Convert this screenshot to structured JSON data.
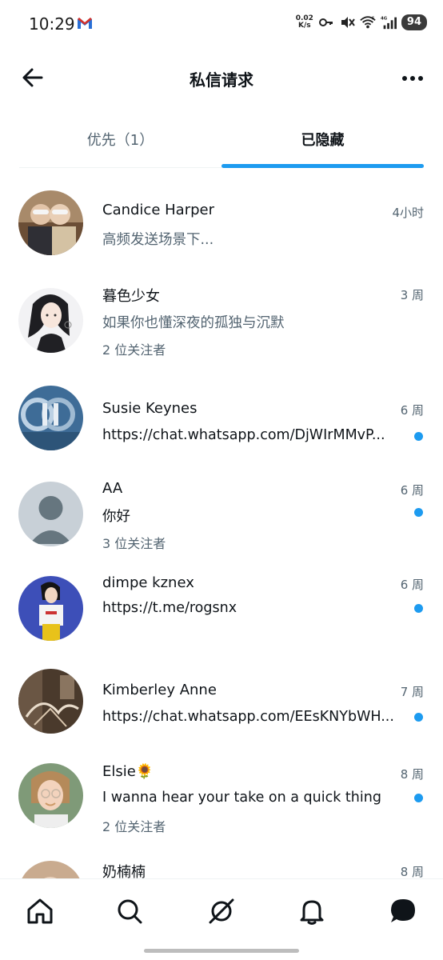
{
  "status_bar": {
    "time": "10:29",
    "speed_value": "0.02",
    "speed_unit": "K/s",
    "battery": "94",
    "network": "4G",
    "wifi_badge": "6"
  },
  "header": {
    "title": "私信请求"
  },
  "tabs": [
    {
      "label": "优先（1）",
      "active": false
    },
    {
      "label": "已隐藏",
      "active": true
    }
  ],
  "conversations": [
    {
      "name": "Candice Harper",
      "time": "4小时",
      "message": "高频发送场景下...",
      "followers": "",
      "unread": false
    },
    {
      "name": "暮色少女",
      "time": "3 周",
      "message": "如果你也懂深夜的孤独与沉默",
      "followers": "2 位关注者",
      "unread": false
    },
    {
      "name": "Susie Keynes",
      "time": "6 周",
      "message": "https://chat.whatsapp.com/DjWIrMMvP...",
      "followers": "",
      "unread": true
    },
    {
      "name": "AA",
      "time": "6 周",
      "message": "你好",
      "followers": "3 位关注者",
      "unread": true
    },
    {
      "name": "dimpe kznex",
      "time": "6 周",
      "message": "https://t.me/rogsnx",
      "followers": "",
      "unread": true
    },
    {
      "name": "Kimberley Anne",
      "time": "7 周",
      "message": "https://chat.whatsapp.com/EEsKNYbWH...",
      "followers": "",
      "unread": true
    },
    {
      "name": "Elsie🌻",
      "time": "8 周",
      "message": "I wanna hear your take on a quick thing",
      "followers": "2 位关注者",
      "unread": true
    },
    {
      "name": "奶楠楠",
      "time": "8 周",
      "message": "",
      "followers": "",
      "unread": false
    }
  ],
  "bottom_nav": [
    {
      "icon": "home-icon"
    },
    {
      "icon": "search-icon"
    },
    {
      "icon": "grok-icon"
    },
    {
      "icon": "notifications-icon"
    },
    {
      "icon": "messages-icon"
    }
  ],
  "colors": {
    "accent": "#1d9bf0",
    "text_primary": "#0f1419",
    "text_secondary": "#536471"
  }
}
